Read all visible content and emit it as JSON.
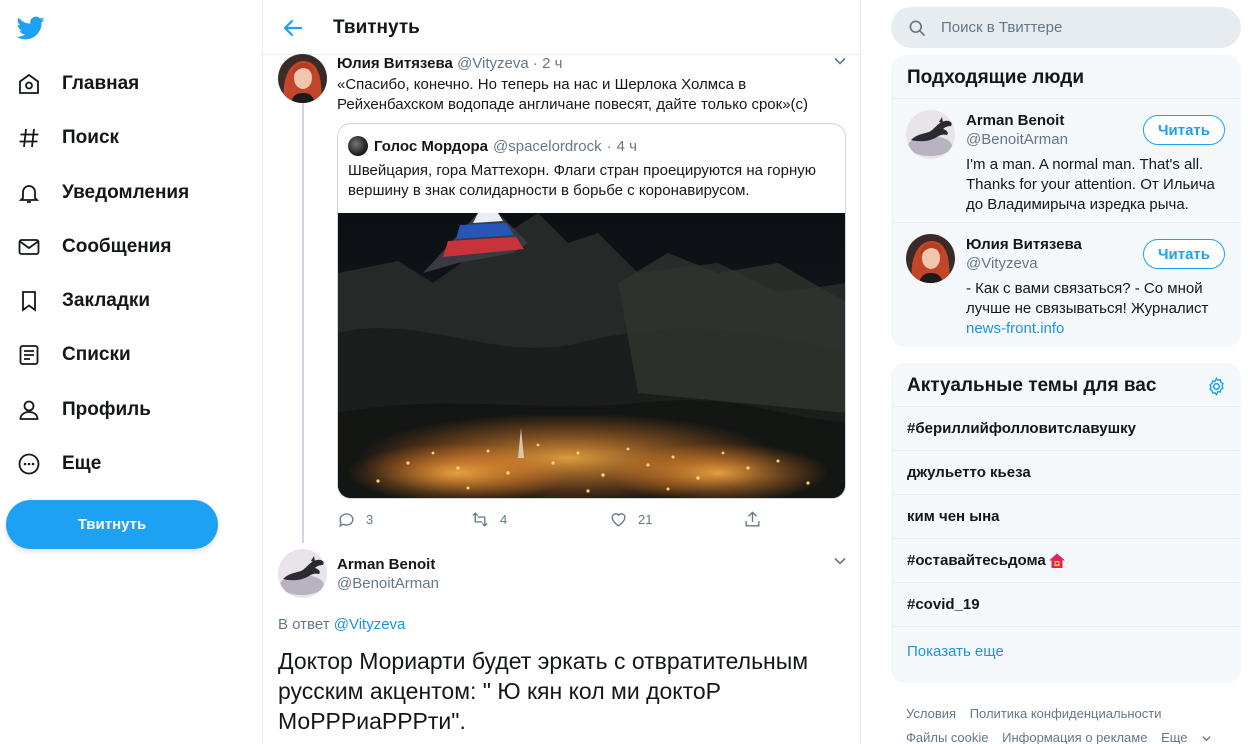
{
  "nav": {
    "items": [
      {
        "label": "Главная",
        "icon": "home-icon"
      },
      {
        "label": "Поиск",
        "icon": "hashtag-icon"
      },
      {
        "label": "Уведомления",
        "icon": "bell-icon"
      },
      {
        "label": "Сообщения",
        "icon": "envelope-icon"
      },
      {
        "label": "Закладки",
        "icon": "bookmark-icon"
      },
      {
        "label": "Списки",
        "icon": "list-icon"
      },
      {
        "label": "Профиль",
        "icon": "person-icon"
      },
      {
        "label": "Еще",
        "icon": "more-circle-icon"
      }
    ],
    "tweet_button": "Твитнуть"
  },
  "header": {
    "title": "Твитнуть"
  },
  "tweet1": {
    "name": "Юлия Витязева",
    "handle": "@Vityzeva",
    "dot": "·",
    "time": "2 ч",
    "text": "«Спасибо, конечно. Но теперь на нас и Шерлока Холмса в Рейхенбахском водопаде англичане повесят, дайте только срок»(с)",
    "quote": {
      "name": "Голос Мордора",
      "handle": "@spacelordrock",
      "dot": "·",
      "time": "4 ч",
      "text": "Швейцария, гора Маттехорн. Флаги стран проецируются на горную вершину в знак солидарности в борьбе с коронавирусом."
    },
    "replies": "3",
    "retweets": "4",
    "likes": "21"
  },
  "tweet2": {
    "name": "Arman Benoit",
    "handle": "@BenoitArman",
    "reply_prefix": "В ответ",
    "reply_handle": "@Vityzeva",
    "text": "Доктор Мориарти будет эркать с отвратительным русским акцентом: \" Ю кян кол ми доктоР МоРРРиаРРРти\"."
  },
  "search": {
    "placeholder": "Поиск в Твиттере"
  },
  "who_to_follow": {
    "title": "Подходящие люди",
    "follow_label": "Читать",
    "users": [
      {
        "name": "Arman Benoit",
        "handle": "@BenoitArman",
        "bio": "I'm a man. A normal man. That's all. Thanks for your attention. От Ильича до Владимирыча изредка рыча.",
        "link": ""
      },
      {
        "name": "Юлия Витязева",
        "handle": "@Vityzeva",
        "bio": "- Как с вами связаться? - Со мной лучше не связываться! Журналист",
        "link": "news-front.info"
      }
    ]
  },
  "trends": {
    "title": "Актуальные темы для вас",
    "items": [
      "#бериллийфолловитславушку",
      "джульетто кьеза",
      "ким чен ына",
      "#оставайтесьдома",
      "#covid_19"
    ],
    "show_more": "Показать еще"
  },
  "footer": {
    "links": [
      "Условия",
      "Политика конфиденциальности",
      "Файлы cookie",
      "Информация о рекламе",
      "Еще"
    ]
  },
  "colors": {
    "accent": "#1da1f2",
    "link": "#1b95e0",
    "text": "#14171a",
    "secondary": "#657786",
    "border": "#e6ecf0"
  }
}
